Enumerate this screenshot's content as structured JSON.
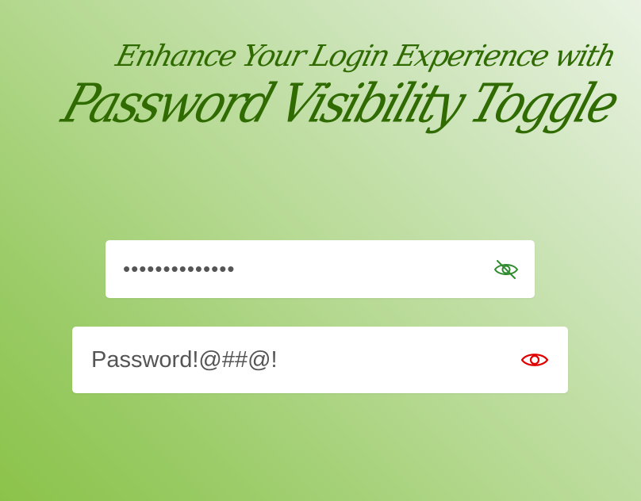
{
  "heading": {
    "line1": "Enhance Your Login Experience with",
    "line2": "Password Visibility Toggle"
  },
  "fields": [
    {
      "value": "Password!@##@!",
      "masked_display": "••••••••••••••",
      "type": "password",
      "toggle_icon": "eye-slash-icon",
      "toggle_color": "#2e8b2e"
    },
    {
      "value": "Password!@##@!",
      "type": "text",
      "toggle_icon": "eye-icon",
      "toggle_color": "#e00000"
    }
  ],
  "colors": {
    "heading": "#2f6b00",
    "background_start": "#eaf3e3",
    "background_end": "#8bc34a",
    "input_text": "#555555"
  }
}
